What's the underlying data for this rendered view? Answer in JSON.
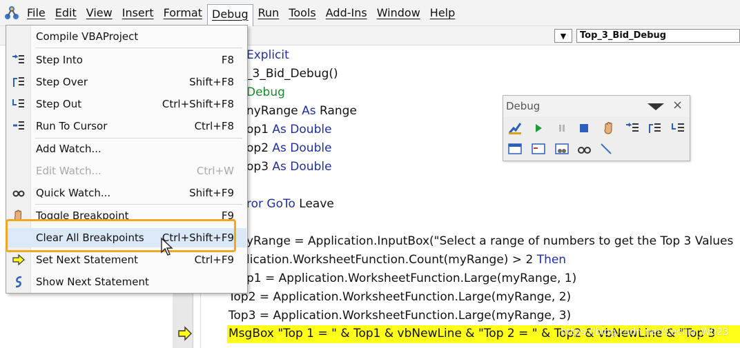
{
  "menubar": {
    "items": [
      "File",
      "Edit",
      "View",
      "Insert",
      "Format",
      "Debug",
      "Run",
      "Tools",
      "Add-Ins",
      "Window",
      "Help"
    ],
    "active": "Debug"
  },
  "procedure_box": {
    "value": "Top_3_Bid_Debug"
  },
  "code": {
    "lines": [
      {
        "parts": [
          {
            "t": "Explicit",
            "kw": true
          }
        ]
      },
      {
        "parts": [
          {
            "t": "_3_Bid_Debug()",
            "kw": false
          }
        ]
      },
      {
        "parts": [
          {
            "t": "Debug",
            "kw": "green"
          }
        ]
      },
      {
        "parts": [
          {
            "t": "nyRange ",
            "kw": false
          },
          {
            "t": "As",
            "kw": true
          },
          {
            "t": " Range",
            "kw": false
          }
        ]
      },
      {
        "parts": [
          {
            "t": "op1 ",
            "kw": false
          },
          {
            "t": "As Double",
            "kw": true
          }
        ]
      },
      {
        "parts": [
          {
            "t": "op2 ",
            "kw": false
          },
          {
            "t": "As Double",
            "kw": true
          }
        ]
      },
      {
        "parts": [
          {
            "t": "op3 ",
            "kw": false
          },
          {
            "t": "As Double",
            "kw": true
          }
        ]
      },
      {
        "parts": [
          {
            "t": "ror GoTo",
            "kw": true
          },
          {
            "t": " Leave",
            "kw": false
          }
        ]
      },
      {
        "parts": [
          {
            "t": "yRange = Application.InputBox(\"Select a range of numbers to get the Top 3 Values",
            "kw": false
          }
        ]
      },
      {
        "parts": [
          {
            "t": "lication.WorksheetFunction.Count(myRange) > 2 ",
            "kw": false
          },
          {
            "t": "Then",
            "kw": true
          }
        ]
      },
      {
        "parts": [
          {
            "t": "p1 = Application.WorksheetFunction.Large(myRange, 1)",
            "kw": false
          }
        ]
      },
      {
        "parts": [
          {
            "t": "Top2 = Application.WorksheetFunction.Large(myRange, 2)",
            "kw": false
          }
        ]
      },
      {
        "parts": [
          {
            "t": "Top3 = Application.WorksheetFunction.Large(myRange, 3)",
            "kw": false
          }
        ]
      },
      {
        "parts": [
          {
            "t": "MsgBox \"Top 1 = \" & Top1 & vbNewLine & \"Top 2 = \" & Top2 & vbNewLine & \"Top 3",
            "kw": false
          }
        ]
      }
    ]
  },
  "debug_toolbar": {
    "title": "Debug",
    "close": "×"
  },
  "debug_menu": {
    "items": [
      {
        "label": "Compile VBAProject",
        "key": "",
        "icon": "none",
        "disabled": false
      },
      {
        "label": "Step Into",
        "key": "F8",
        "icon": "step-into-icon",
        "disabled": false
      },
      {
        "label": "Step Over",
        "key": "Shift+F8",
        "icon": "step-over-icon",
        "disabled": false
      },
      {
        "label": "Step Out",
        "key": "Ctrl+Shift+F8",
        "icon": "step-out-icon",
        "disabled": false
      },
      {
        "label": "Run To Cursor",
        "key": "Ctrl+F8",
        "icon": "run-to-cursor-icon",
        "disabled": false
      },
      {
        "label": "Add Watch...",
        "key": "",
        "icon": "none",
        "disabled": false
      },
      {
        "label": "Edit Watch...",
        "key": "Ctrl+W",
        "icon": "none",
        "disabled": true
      },
      {
        "label": "Quick Watch...",
        "key": "Shift+F9",
        "icon": "quick-watch-icon",
        "disabled": false
      },
      {
        "label": "Toggle Breakpoint",
        "key": "F9",
        "icon": "hand-icon",
        "disabled": false
      },
      {
        "label": "Clear All Breakpoints",
        "key": "Ctrl+Shift+F9",
        "icon": "none",
        "disabled": false
      },
      {
        "label": "Set Next Statement",
        "key": "Ctrl+F9",
        "icon": "set-next-icon",
        "disabled": false
      },
      {
        "label": "Show Next Statement",
        "key": "",
        "icon": "show-next-icon",
        "disabled": false
      }
    ],
    "highlighted": "Clear All Breakpoints"
  },
  "watermark": "https://blog.csdn.net/Cecilia_W023",
  "colors": {
    "accent": "#f1a81f",
    "keyword": "#1f2ea0",
    "exec_line": "#ffff1a",
    "menu_hover": "#dbe8f7"
  }
}
